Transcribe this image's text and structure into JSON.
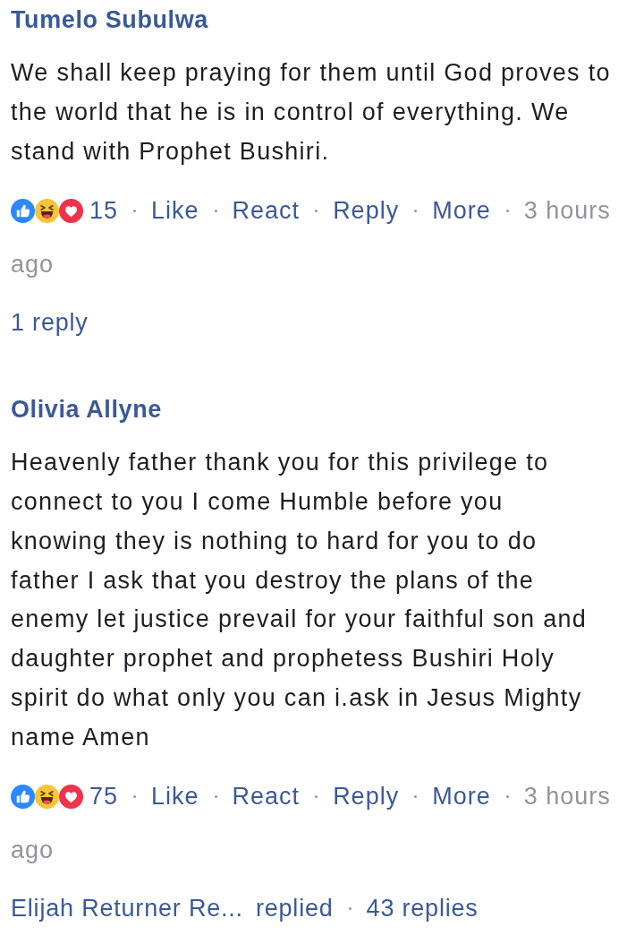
{
  "comments": [
    {
      "author": "Tumelo Subulwa",
      "text": "We shall keep praying for them until God proves to\nthe world that he is in control of everything. We\nstand with Prophet Bushiri.",
      "reactions": [
        {
          "kind": "like"
        },
        {
          "kind": "haha"
        },
        {
          "kind": "love"
        }
      ],
      "reaction_count": "15",
      "actions": [
        "Like",
        "React",
        "Reply",
        "More"
      ],
      "time_lines": [
        "3 hours",
        "ago"
      ],
      "replies": {
        "link": "1 reply"
      }
    },
    {
      "author": "Olivia Allyne",
      "text": "Heavenly father thank you for this privilege to\nconnect to you I come Humble before you\nknowing they is nothing to hard for you to do\nfather I ask that you destroy the plans of the\nenemy let justice prevail for your faithful son and\ndaughter prophet and prophetess Bushiri Holy\nspirit do what only you can i.ask in Jesus Mighty\nname Amen",
      "reactions": [
        {
          "kind": "like"
        },
        {
          "kind": "haha"
        },
        {
          "kind": "love"
        }
      ],
      "reaction_count": "75",
      "actions": [
        "Like",
        "React",
        "Reply",
        "More"
      ],
      "time_lines": [
        "3 hours",
        "ago"
      ],
      "replies": {
        "replier": "Elijah Returner Re...",
        "verb": "replied",
        "link": "43 replies"
      }
    }
  ]
}
